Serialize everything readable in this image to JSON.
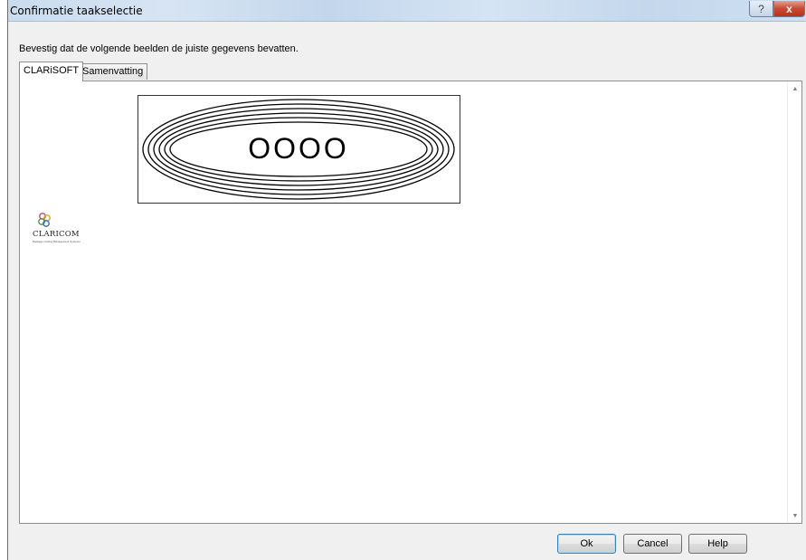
{
  "window": {
    "title": "Confirmatie taakselectie",
    "help_glyph": "?",
    "close_glyph": "x"
  },
  "instruction": "Bevestig dat de volgende beelden de juiste gegevens bevatten.",
  "tabs": [
    {
      "label": "CLARiSOFT",
      "active": true
    },
    {
      "label": "Samenvatting",
      "active": false
    }
  ],
  "preview": {
    "label_text": "OOOO",
    "logo_name": "CLARICOM",
    "logo_tagline": "Package Coding Management Systems"
  },
  "scrollbar": {
    "up_glyph": "▲",
    "down_glyph": "▼"
  },
  "buttons": {
    "ok": "Ok",
    "cancel": "Cancel",
    "help": "Help"
  }
}
